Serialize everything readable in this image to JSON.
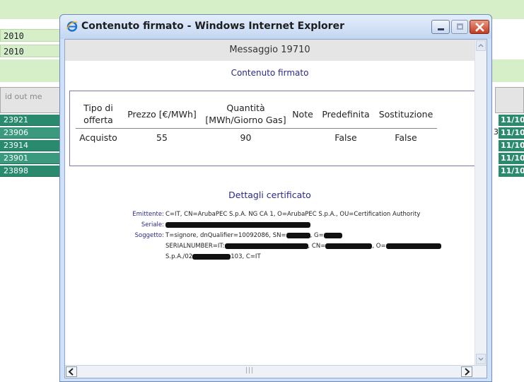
{
  "background": {
    "dates": [
      "2010",
      "2010"
    ],
    "table_header": "id out me",
    "ids": [
      "23921",
      "23906",
      "23914",
      "23901",
      "23898"
    ],
    "right_cells": [
      "11/10",
      "11/10",
      "11/10",
      "11/10",
      "11/10"
    ],
    "stray_char": "3",
    "colors": {
      "page_green": "#d6efc9",
      "row_teal": "#2a8a6e",
      "header_gray": "#e4e4e4"
    }
  },
  "window": {
    "title": "Contenuto firmato - Windows Internet Explorer",
    "icon": "ie-icon",
    "controls": [
      "minimize-icon",
      "maximize-icon",
      "close-icon"
    ]
  },
  "message": {
    "header": "Messaggio 19710",
    "subtitle": "Contenuto firmato",
    "table": {
      "headers": [
        "Tipo di offerta",
        "Prezzo [€/MWh]",
        "Quantità [MWh/Giorno Gas]",
        "Note",
        "Predefinita",
        "Sostituzione"
      ],
      "rows": [
        [
          "Acquisto",
          "55",
          "90",
          "",
          "False",
          "False"
        ]
      ]
    }
  },
  "certificate": {
    "title": "Dettagli certificato",
    "emittente_label": "Emittente:",
    "emittente_value": "C=IT, CN=ArubaPEC S.p.A. NG CA 1, O=ArubaPEC S.p.A., OU=Certification Authority",
    "seriale_label": "Seriale:",
    "soggetto_label": "Soggetto:",
    "soggetto_line1_a": "T=signore, dnQualifier=10092086, SN=",
    "soggetto_line1_b": ", G=",
    "soggetto_line2_a": "SERIALNUMBER=IT:",
    "soggetto_line2_b": ", CN=",
    "soggetto_line2_c": ", O=",
    "soggetto_line3_a": "S.p.A./02",
    "soggetto_line3_b": "103, C=IT"
  }
}
